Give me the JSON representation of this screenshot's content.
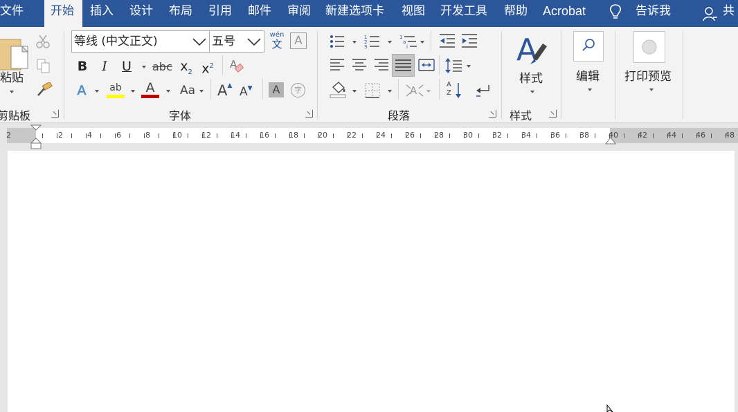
{
  "tabs": [
    {
      "label": "文件"
    },
    {
      "label": "开始"
    },
    {
      "label": "插入"
    },
    {
      "label": "设计"
    },
    {
      "label": "布局"
    },
    {
      "label": "引用"
    },
    {
      "label": "邮件"
    },
    {
      "label": "审阅"
    },
    {
      "label": "新建选项卡"
    },
    {
      "label": "视图"
    },
    {
      "label": "开发工具"
    },
    {
      "label": "帮助"
    },
    {
      "label": "Acrobat"
    }
  ],
  "tell_me": "告诉我",
  "share": "共",
  "clipboard": {
    "paste_label": "粘贴",
    "group_label": "剪贴板"
  },
  "font": {
    "font_name": "等线 (中文正文)",
    "font_size": "五号",
    "phonetic_top": "wén",
    "phonetic_bottom": "文",
    "char_border": "A",
    "bold": "B",
    "italic": "I",
    "underline": "U",
    "strike": "abc",
    "subscript": "x",
    "subscript_small": "2",
    "superscript": "x",
    "superscript_small": "2",
    "text_effect": "A",
    "highlight": "ab",
    "font_color": "A",
    "change_case": "Aa",
    "grow": "A",
    "shrink": "A",
    "char_shading": "A",
    "enclose": "字",
    "group_label": "字体"
  },
  "paragraph": {
    "group_label": "段落",
    "sort": "A↓Z"
  },
  "styles": {
    "button_label": "样式",
    "group_label": "样式"
  },
  "editing": {
    "button_label": "编辑"
  },
  "print_preview": {
    "button_label": "打印预览"
  },
  "ruler": {
    "labels": [
      "2",
      "2",
      "4",
      "6",
      "8",
      "10",
      "12",
      "14",
      "16",
      "18",
      "20",
      "22",
      "24",
      "26",
      "28",
      "30",
      "32",
      "34",
      "36",
      "38",
      "40",
      "42",
      "44",
      "46",
      "48"
    ]
  },
  "colors": {
    "accent": "#2b579a",
    "highlight": "#ffff00",
    "font_color": "#c00000"
  }
}
